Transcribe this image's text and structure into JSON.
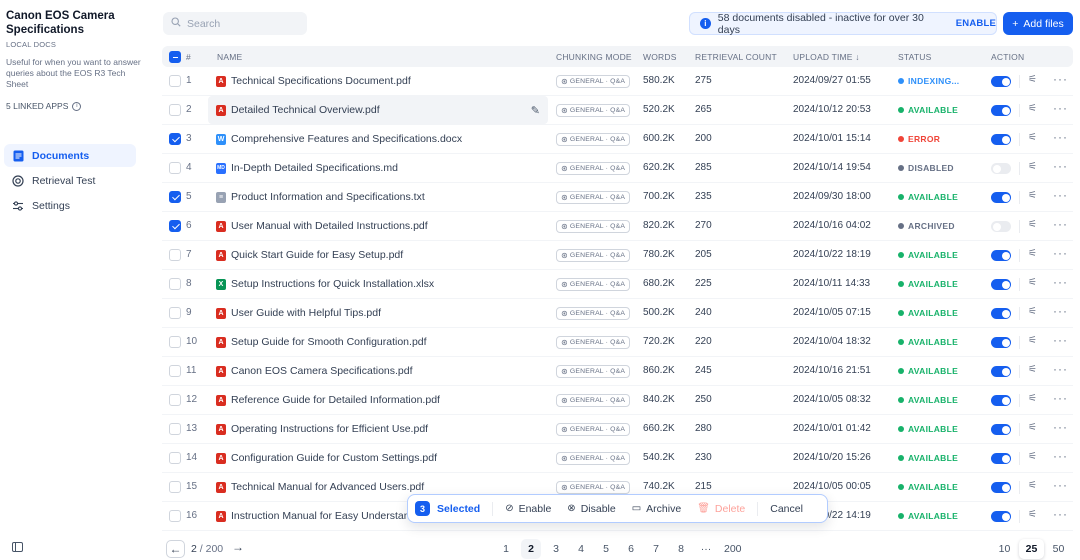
{
  "sidebar": {
    "kb_title": "Canon EOS Camera Specifications",
    "kb_type": "LOCAL DOCS",
    "kb_description": "Useful for when you want to answer queries about the EOS R3 Tech Sheet",
    "linked_apps": "5 LINKED APPS",
    "nav": [
      {
        "label": "Documents",
        "icon": "document-icon",
        "active": true
      },
      {
        "label": "Retrieval Test",
        "icon": "target-icon",
        "active": false
      },
      {
        "label": "Settings",
        "icon": "sliders-icon",
        "active": false
      }
    ]
  },
  "toolbar": {
    "search_placeholder": "Search",
    "notice_text": "58 documents disabled - inactive for over 30 days",
    "notice_action": "ENABLE",
    "add_files_label": "Add files"
  },
  "table": {
    "headers": {
      "num": "#",
      "name": "NAME",
      "chunking": "CHUNKING MODE",
      "words": "WORDS",
      "retrieval": "RETRIEVAL COUNT",
      "upload": "UPLOAD TIME",
      "status": "STATUS",
      "action": "ACTION"
    },
    "sort_indicator": "↓",
    "rows": [
      {
        "n": "1",
        "name": "Technical Specifications Document.pdf",
        "type": "pdf",
        "chunk": "GENERAL · Q&A",
        "words": "580.2K",
        "retrieval": "275",
        "upload": "2024/09/27 01:55",
        "status": "INDEXING...",
        "status_color": "#2e90fa",
        "enabled": true,
        "checked": false
      },
      {
        "n": "2",
        "name": "Detailed Technical Overview.pdf",
        "type": "pdf",
        "chunk": "GENERAL · Q&A",
        "words": "520.2K",
        "retrieval": "265",
        "upload": "2024/10/12 20:53",
        "status": "AVAILABLE",
        "status_color": "#17b26a",
        "enabled": true,
        "checked": false,
        "hover": true
      },
      {
        "n": "3",
        "name": "Comprehensive Features and Specifications.docx",
        "type": "docx",
        "chunk": "GENERAL · Q&A",
        "words": "600.2K",
        "retrieval": "200",
        "upload": "2024/10/01 15:14",
        "status": "ERROR",
        "status_color": "#f04438",
        "enabled": true,
        "checked": true
      },
      {
        "n": "4",
        "name": "In-Depth Detailed Specifications.md",
        "type": "md",
        "chunk": "GENERAL · Q&A",
        "words": "620.2K",
        "retrieval": "285",
        "upload": "2024/10/14 19:54",
        "status": "DISABLED",
        "status_color": "#667085",
        "enabled": false,
        "checked": false
      },
      {
        "n": "5",
        "name": "Product Information and Specifications.txt",
        "type": "txt",
        "chunk": "GENERAL · Q&A",
        "words": "700.2K",
        "retrieval": "235",
        "upload": "2024/09/30 18:00",
        "status": "AVAILABLE",
        "status_color": "#17b26a",
        "enabled": true,
        "checked": true
      },
      {
        "n": "6",
        "name": "User Manual with Detailed Instructions.pdf",
        "type": "pdf",
        "chunk": "GENERAL · Q&A",
        "words": "820.2K",
        "retrieval": "270",
        "upload": "2024/10/16 04:02",
        "status": "ARCHIVED",
        "status_color": "#667085",
        "enabled": false,
        "checked": true
      },
      {
        "n": "7",
        "name": "Quick Start Guide for Easy Setup.pdf",
        "type": "pdf",
        "chunk": "GENERAL · Q&A",
        "words": "780.2K",
        "retrieval": "205",
        "upload": "2024/10/22 18:19",
        "status": "AVAILABLE",
        "status_color": "#17b26a",
        "enabled": true,
        "checked": false
      },
      {
        "n": "8",
        "name": "Setup Instructions for Quick Installation.xlsx",
        "type": "xlsx",
        "chunk": "GENERAL · Q&A",
        "words": "680.2K",
        "retrieval": "225",
        "upload": "2024/10/11 14:33",
        "status": "AVAILABLE",
        "status_color": "#17b26a",
        "enabled": true,
        "checked": false
      },
      {
        "n": "9",
        "name": "User Guide with Helpful Tips.pdf",
        "type": "pdf",
        "chunk": "GENERAL · Q&A",
        "words": "500.2K",
        "retrieval": "240",
        "upload": "2024/10/05 07:15",
        "status": "AVAILABLE",
        "status_color": "#17b26a",
        "enabled": true,
        "checked": false
      },
      {
        "n": "10",
        "name": "Setup Guide for Smooth Configuration.pdf",
        "type": "pdf",
        "chunk": "GENERAL · Q&A",
        "words": "720.2K",
        "retrieval": "220",
        "upload": "2024/10/04 18:32",
        "status": "AVAILABLE",
        "status_color": "#17b26a",
        "enabled": true,
        "checked": false
      },
      {
        "n": "11",
        "name": "Canon EOS Camera Specifications.pdf",
        "type": "pdf",
        "chunk": "GENERAL · Q&A",
        "words": "860.2K",
        "retrieval": "245",
        "upload": "2024/10/16 21:51",
        "status": "AVAILABLE",
        "status_color": "#17b26a",
        "enabled": true,
        "checked": false
      },
      {
        "n": "12",
        "name": "Reference Guide for Detailed Information.pdf",
        "type": "pdf",
        "chunk": "GENERAL · Q&A",
        "words": "840.2K",
        "retrieval": "250",
        "upload": "2024/10/05 08:32",
        "status": "AVAILABLE",
        "status_color": "#17b26a",
        "enabled": true,
        "checked": false
      },
      {
        "n": "13",
        "name": "Operating Instructions for Efficient Use.pdf",
        "type": "pdf",
        "chunk": "GENERAL · Q&A",
        "words": "660.2K",
        "retrieval": "280",
        "upload": "2024/10/01 01:42",
        "status": "AVAILABLE",
        "status_color": "#17b26a",
        "enabled": true,
        "checked": false
      },
      {
        "n": "14",
        "name": "Configuration Guide for Custom Settings.pdf",
        "type": "pdf",
        "chunk": "GENERAL · Q&A",
        "words": "540.2K",
        "retrieval": "230",
        "upload": "2024/10/20 15:26",
        "status": "AVAILABLE",
        "status_color": "#17b26a",
        "enabled": true,
        "checked": false
      },
      {
        "n": "15",
        "name": "Technical Manual for Advanced Users.pdf",
        "type": "pdf",
        "chunk": "GENERAL · Q&A",
        "words": "740.2K",
        "retrieval": "215",
        "upload": "2024/10/05 00:05",
        "status": "AVAILABLE",
        "status_color": "#17b26a",
        "enabled": true,
        "checked": false
      },
      {
        "n": "16",
        "name": "Instruction Manual for Easy Understanding.pdf",
        "type": "pdf",
        "chunk": "GENERAL · Q&A",
        "words": "",
        "retrieval": "",
        "upload": "2024/10/22 14:19",
        "status": "AVAILABLE",
        "status_color": "#17b26a",
        "enabled": true,
        "checked": false
      }
    ]
  },
  "batch": {
    "count": "3",
    "selected_label": "Selected",
    "enable_label": "Enable",
    "disable_label": "Disable",
    "archive_label": "Archive",
    "delete_label": "Delete",
    "cancel_label": "Cancel"
  },
  "pagination": {
    "current": "2",
    "total": "/ 200",
    "pages": [
      "1",
      "2",
      "3",
      "4",
      "5",
      "6",
      "7",
      "8",
      "···",
      "200"
    ],
    "active_page": "2",
    "page_sizes": [
      "10",
      "25",
      "50"
    ],
    "active_size": "25"
  },
  "colors": {
    "accent": "#155eef",
    "available": "#17b26a",
    "error": "#f04438",
    "indexing": "#2e90fa",
    "disabled": "#667085"
  }
}
